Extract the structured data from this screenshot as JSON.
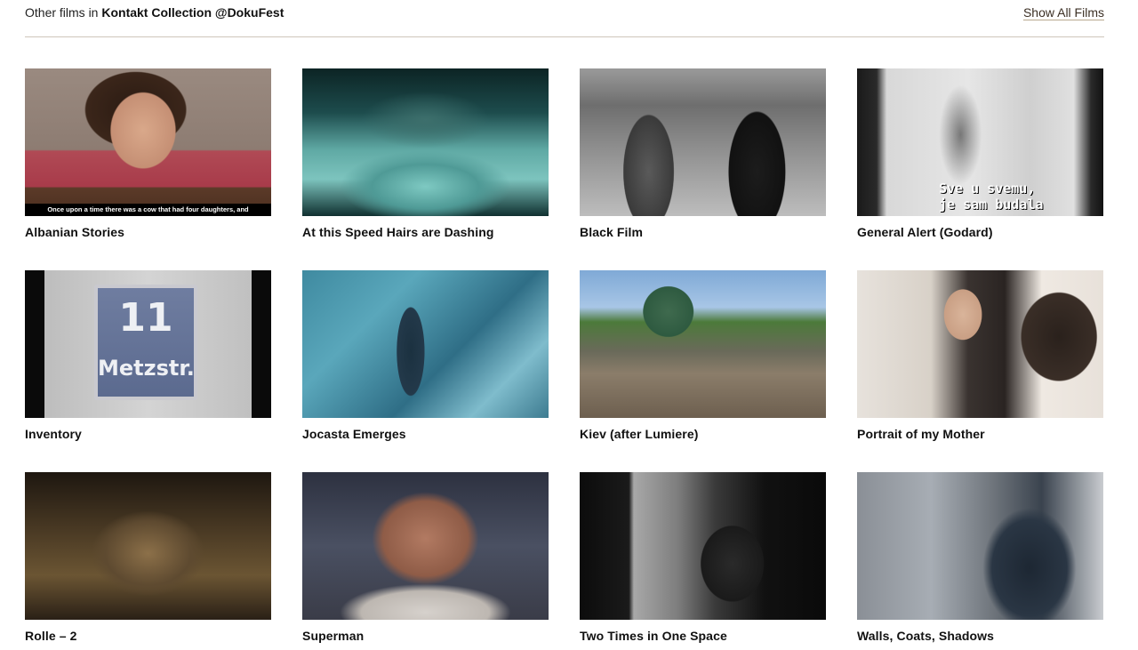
{
  "header": {
    "lead_text": "Other films in ",
    "collection_name": "Kontakt Collection @DokuFest",
    "show_all_label": "Show All Films"
  },
  "films": [
    {
      "title": "Albanian Stories",
      "caption": "Once upon a time there was a cow that had four daughters, and"
    },
    {
      "title": "At this Speed Hairs are Dashing"
    },
    {
      "title": "Black Film"
    },
    {
      "title": "General Alert (Godard)",
      "subtitle_line1": "Sve u svemu,",
      "subtitle_line2": "je sam budala"
    },
    {
      "title": "Inventory",
      "sign_number": "11",
      "sign_street": "Metzstr."
    },
    {
      "title": "Jocasta Emerges"
    },
    {
      "title": "Kiev (after Lumiere)"
    },
    {
      "title": "Portrait of my Mother"
    },
    {
      "title": "Rolle – 2"
    },
    {
      "title": "Superman"
    },
    {
      "title": "Two Times in One Space"
    },
    {
      "title": "Walls, Coats, Shadows"
    }
  ]
}
